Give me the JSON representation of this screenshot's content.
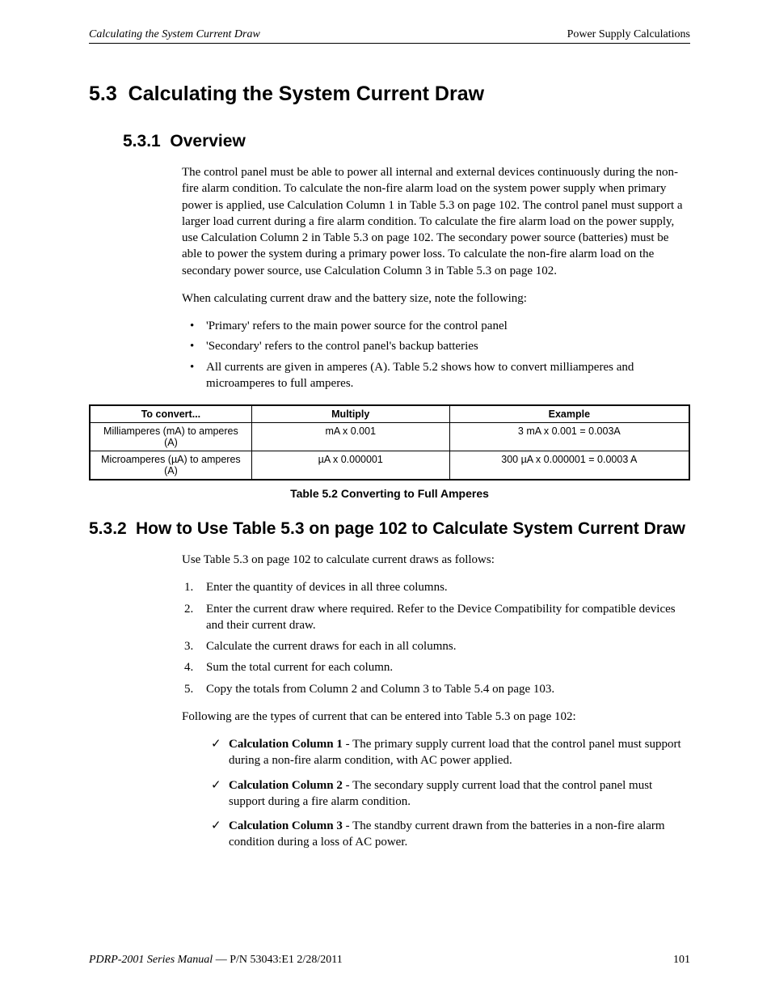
{
  "header": {
    "left": "Calculating the System Current Draw",
    "right": "Power Supply Calculations"
  },
  "section": {
    "number": "5.3",
    "title": "Calculating the System Current Draw"
  },
  "sub1": {
    "number": "5.3.1",
    "title": "Overview",
    "para1": "The control panel must be able to power all internal and external devices continuously during the non-fire alarm condition.  To calculate the non-fire alarm load on the system power supply when primary power is applied, use Calculation Column 1 in Table 5.3 on page 102.  The control panel must support a larger load current during a fire alarm condition.  To calculate the fire alarm load on the power supply, use Calculation Column 2 in Table 5.3 on page 102.  The secondary power source (batteries) must be able to power the system during a primary power loss.  To calculate the non-fire alarm load on the secondary power source, use Calculation Column 3 in Table 5.3 on page 102.",
    "para2": "When calculating current draw and the battery size, note the following:",
    "bullets": [
      "'Primary' refers to the main power source for the control panel",
      "'Secondary' refers to the control panel's backup batteries",
      "All currents are given in amperes (A).  Table 5.2  shows how to convert milliamperes and microamperes to full amperes."
    ]
  },
  "table52": {
    "headers": [
      "To convert...",
      "Multiply",
      "Example"
    ],
    "rows": [
      [
        "Milliamperes (mA) to amperes (A)",
        "mA x 0.001",
        "3 mA x 0.001 = 0.003A"
      ],
      [
        "Microamperes (µA) to amperes (A)",
        "µA x 0.000001",
        "300 µA x 0.000001 = 0.0003 A"
      ]
    ],
    "caption": "Table 5.2  Converting to Full Amperes"
  },
  "sub2": {
    "number": "5.3.2",
    "title": "How to Use Table 5.3 on page 102 to Calculate System Current Draw",
    "intro": "Use Table 5.3 on page 102 to calculate current draws as follows:",
    "steps": [
      "Enter the quantity of devices in all three columns.",
      "Enter the current draw where required.  Refer to the Device Compatibility  for compatible devices and their current draw.",
      "Calculate the current draws for each in all columns.",
      "Sum the total current for each column.",
      "Copy the totals from Column 2 and Column 3 to Table 5.4 on page 103."
    ],
    "following": "Following are the types of current that can be entered into Table 5.3 on page 102:",
    "checks": [
      {
        "label": "Calculation Column 1",
        "text": " - The primary supply current load that the control panel must support during a non-fire alarm condition, with AC power applied."
      },
      {
        "label": "Calculation Column 2",
        "text": " - The secondary supply current load that the control panel must support during a fire alarm condition."
      },
      {
        "label": "Calculation Column 3",
        "text": " - The standby current drawn from the batteries in a non-fire alarm condition during a loss of AC power."
      }
    ]
  },
  "footer": {
    "left_italic": "PDRP-2001 Series Manual",
    "left_rest": " — P/N 53043:E1  2/28/2011",
    "page": "101"
  }
}
